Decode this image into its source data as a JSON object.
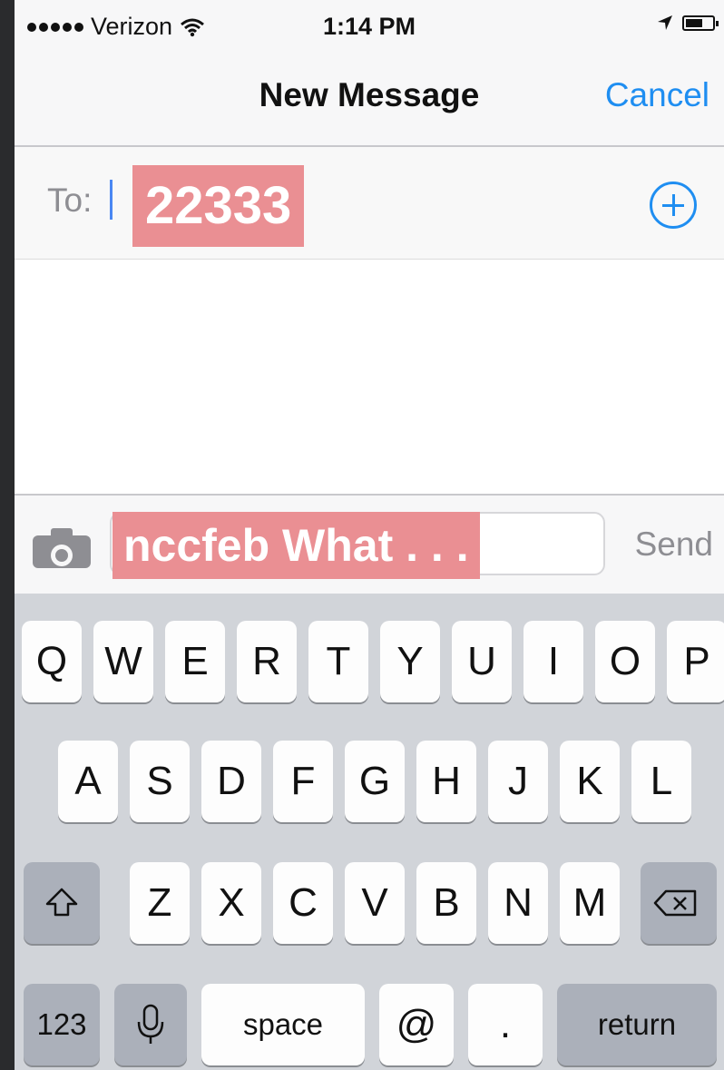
{
  "status_bar": {
    "carrier": "Verizon",
    "time": "1:14 PM"
  },
  "nav": {
    "title": "New Message",
    "cancel_label": "Cancel"
  },
  "to_field": {
    "label": "To:",
    "recipient": "22333"
  },
  "compose": {
    "message_text": "nccfeb What . . .",
    "send_label": "Send"
  },
  "keyboard": {
    "row1": [
      "Q",
      "W",
      "E",
      "R",
      "T",
      "Y",
      "U",
      "I",
      "O",
      "P"
    ],
    "row2": [
      "A",
      "S",
      "D",
      "F",
      "G",
      "H",
      "J",
      "K",
      "L"
    ],
    "row3": [
      "Z",
      "X",
      "C",
      "V",
      "B",
      "N",
      "M"
    ],
    "numbers_label": "123",
    "space_label": "space",
    "at_label": "@",
    "period_label": ".",
    "return_label": "return"
  },
  "colors": {
    "accent": "#1f8ef1",
    "highlight": "#ea8f93",
    "keyboard_bg": "#d1d4d9"
  },
  "icons": [
    "signal-dots-icon",
    "wifi-icon",
    "location-arrow-icon",
    "battery-icon",
    "add-contact-icon",
    "camera-icon",
    "shift-icon",
    "microphone-icon",
    "delete-icon"
  ]
}
